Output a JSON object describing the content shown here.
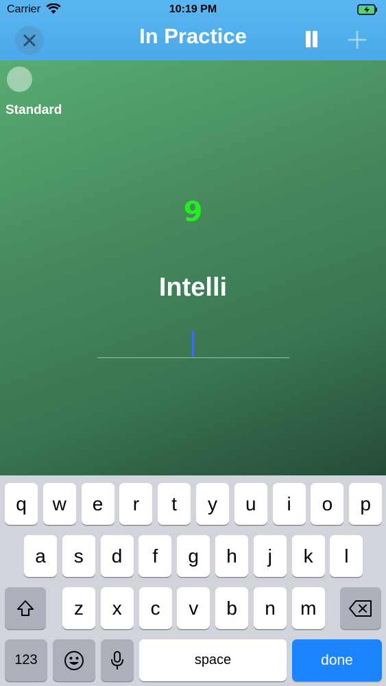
{
  "status_bar": {
    "carrier": "Carrier",
    "time": "10:19 PM"
  },
  "nav": {
    "title": "In Practice",
    "close_icon": "close-icon",
    "pause_icon": "pause-icon",
    "add_icon": "plus-icon"
  },
  "game": {
    "mode_label": "Standard",
    "countdown": "9",
    "word": "Intelli",
    "answer_value": ""
  },
  "keyboard": {
    "row1": [
      "q",
      "w",
      "e",
      "r",
      "t",
      "y",
      "u",
      "i",
      "o",
      "p"
    ],
    "row2": [
      "a",
      "s",
      "d",
      "f",
      "g",
      "h",
      "j",
      "k",
      "l"
    ],
    "row3": [
      "z",
      "x",
      "c",
      "v",
      "b",
      "n",
      "m"
    ],
    "numbers_label": "123",
    "space_label": "space",
    "done_label": "done",
    "icons": [
      "shift-icon",
      "backspace-icon",
      "emoji-icon",
      "microphone-icon"
    ]
  },
  "colors": {
    "header": "#4aa9ea",
    "countdown": "#22ee22",
    "done_key": "#1b84ff",
    "caret": "#3b6ff0"
  }
}
